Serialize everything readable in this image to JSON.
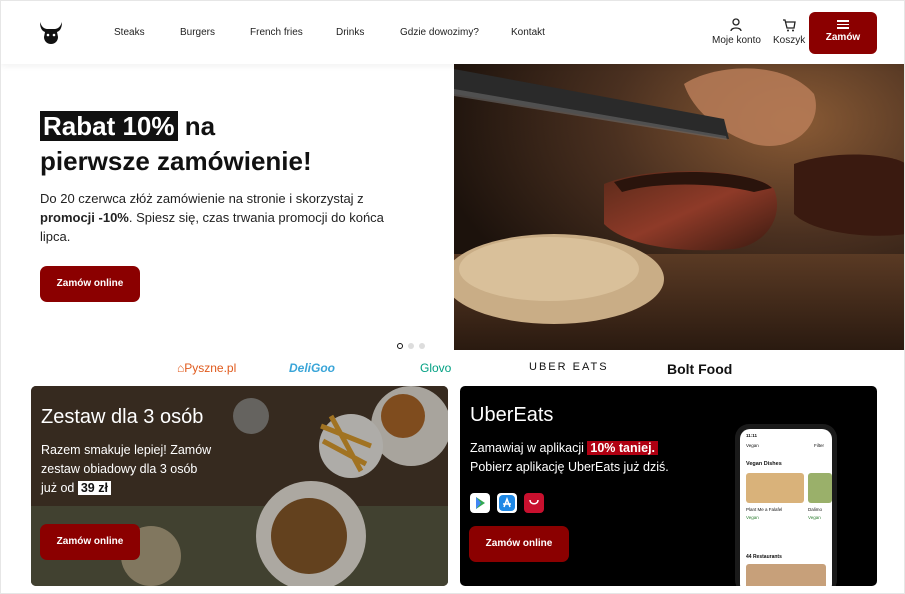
{
  "header": {
    "nav": [
      "Steaks",
      "Burgers",
      "French fries",
      "Drinks",
      "Gdzie dowozimy?",
      "Kontakt"
    ],
    "account_label": "Moje konto",
    "cart_label": "Koszyk",
    "order_label": "Zamów"
  },
  "hero": {
    "title_highlight": "Rabat 10%",
    "title_rest1": " na",
    "title_line2": "pierwsze zamówienie!",
    "text_part1": "Do 20 czerwca złóż zamówienie na stronie i skorzystaj z ",
    "text_bold": "promocji -10%",
    "text_part2": ". Spiesz się, czas trwania promocji do końca lipca.",
    "button": "Zamów online",
    "slides": 3,
    "active_slide": 1
  },
  "partners": [
    "Pyszne.pl",
    "DeliGoo",
    "Glovo",
    "UBER EATS",
    "Bolt Food"
  ],
  "cards": {
    "left": {
      "title": "Zestaw dla 3 osób",
      "line1": "Razem smakuje lepiej! Zamów",
      "line2": "zestaw obiadowy dla 3 osób",
      "line3_prefix": "już od ",
      "price": "39 zł",
      "button": "Zamów online"
    },
    "right": {
      "title": "UberEats",
      "line1_prefix": "Zamawiaj w aplikacji ",
      "line1_tag": "10% taniej.",
      "line2": "Pobierz aplikację UberEats już dziś.",
      "stores": [
        "google-play-icon",
        "app-store-icon",
        "huawei-appgallery-icon"
      ],
      "button": "Zamów online",
      "phone": {
        "time": "11:11",
        "tab_left": "Vegan",
        "tab_right": "Filter",
        "section": "Vegan Dishes",
        "item1": "Plant Me a Falafel",
        "item2": "Dalimo",
        "item1_sub": "Vegan",
        "item2_sub": "Vegan",
        "footer": "44 Restaurants"
      }
    }
  },
  "colors": {
    "brand_red": "#8b0000",
    "accent_red": "#b00012"
  }
}
